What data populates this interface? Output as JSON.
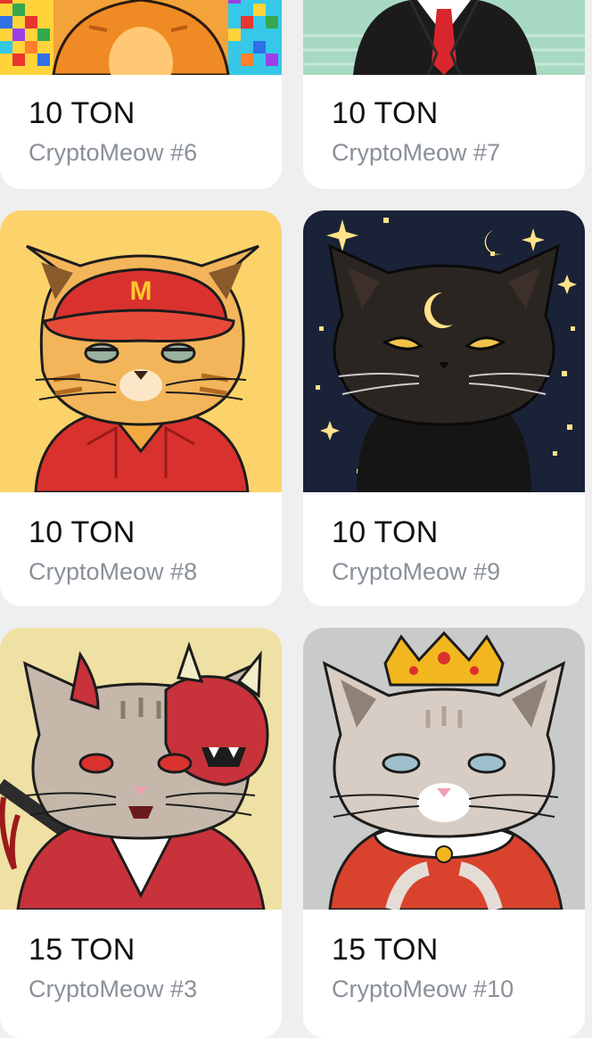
{
  "cards": [
    {
      "price": "10 TON",
      "name": "CryptoMeow #6",
      "image": "orange-cat-rainbow-art"
    },
    {
      "price": "10 TON",
      "name": "CryptoMeow #7",
      "image": "cat-in-suit-art"
    },
    {
      "price": "10 TON",
      "name": "CryptoMeow #8",
      "image": "mcdonalds-cat-art"
    },
    {
      "price": "10 TON",
      "name": "CryptoMeow #9",
      "image": "black-moon-cat-art"
    },
    {
      "price": "15 TON",
      "name": "CryptoMeow #3",
      "image": "samurai-oni-cat-art"
    },
    {
      "price": "15 TON",
      "name": "CryptoMeow #10",
      "image": "king-cat-art"
    }
  ],
  "colors": {
    "background": "#efefef",
    "card": "#ffffff",
    "price": "#111111",
    "name": "#8a9099"
  }
}
